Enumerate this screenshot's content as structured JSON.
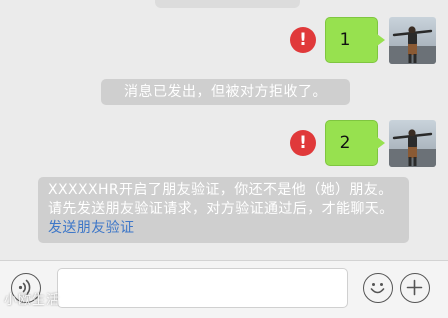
{
  "messages": [
    {
      "text": "1",
      "status_icon": "!"
    },
    {
      "text": "2",
      "status_icon": "!"
    }
  ],
  "notices": {
    "rejected": "消息已发出，但被对方拒收了。",
    "verify_text": "XXXXXHR开启了朋友验证，你还不是他（她）朋友。请先发送朋友验证请求，对方验证通过后，才能聊天。",
    "verify_link": "发送朋友验证"
  },
  "input": {
    "placeholder": ""
  },
  "watermark": "小欧生活",
  "colors": {
    "bubble": "#97e14f",
    "warning": "#e0393a",
    "notice_bg": "#cfcfcf",
    "link": "#3e77c8"
  },
  "icons": {
    "voice": "voice-icon",
    "emoji": "emoji-icon",
    "more": "plus-icon"
  }
}
